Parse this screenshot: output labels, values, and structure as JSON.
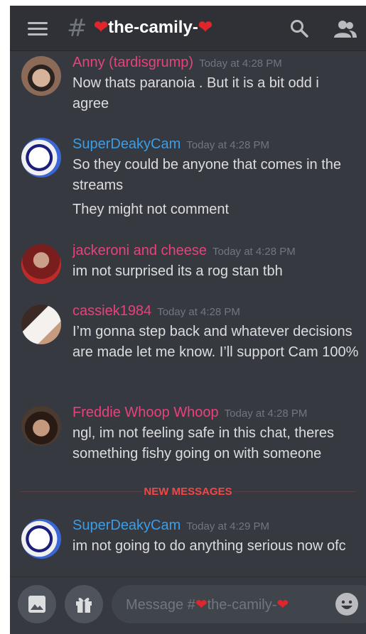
{
  "header": {
    "channel_hash": "#",
    "channel_name": "the-camily-",
    "channel_name_heart": "❤",
    "heart_prefix": "❤"
  },
  "messages": [
    {
      "author": "Anny (tardisgrump)",
      "color": "pink",
      "timestamp": "Today at 4:28 PM",
      "lines": [
        "Now thats paranoia . But it is a bit odd i agree"
      ]
    },
    {
      "author": "SuperDeakyCam",
      "color": "blue",
      "timestamp": "Today at 4:28 PM",
      "lines": [
        "So they could be anyone that comes in the streams",
        "They might not comment"
      ]
    },
    {
      "author": "jackeroni and cheese",
      "color": "pink",
      "timestamp": "Today at 4:28 PM",
      "lines": [
        "im not surprised its a rog stan tbh"
      ]
    },
    {
      "author": "cassiek1984",
      "color": "pink",
      "timestamp": "Today at 4:28 PM",
      "lines": [
        "I’m gonna step back and whatever decisions are made let me know. I’ll support Cam 100%"
      ]
    },
    {
      "author": "Freddie Whoop Whoop",
      "color": "pink",
      "timestamp": "Today at 4:28 PM",
      "lines": [
        "ngl, im not feeling safe in this chat, theres something fishy going on with someone"
      ]
    },
    {
      "author": "SuperDeakyCam",
      "color": "blue",
      "timestamp": "Today at 4:29 PM",
      "lines": [
        "im not going to do anything serious now ofc"
      ]
    }
  ],
  "divider": {
    "label": "NEW MESSAGES"
  },
  "composer": {
    "placeholder_prefix": "Message #",
    "placeholder_channel": "the-camily-",
    "heart": "❤"
  },
  "colors": {
    "background": "#36393f",
    "header": "#303136",
    "pink_author": "#e8417f",
    "blue_author": "#3a9ee8",
    "new_messages": "#f04747"
  }
}
